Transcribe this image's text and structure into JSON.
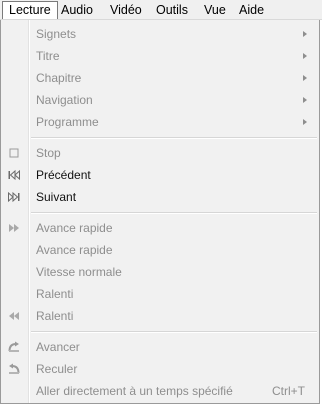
{
  "menubar": {
    "items": [
      {
        "label": "Lecture"
      },
      {
        "label": "Audio"
      },
      {
        "label": "Vidéo"
      },
      {
        "label": "Outils"
      },
      {
        "label": "Vue"
      },
      {
        "label": "Aide"
      }
    ]
  },
  "menu": {
    "items": [
      {
        "label": "Signets"
      },
      {
        "label": "Titre"
      },
      {
        "label": "Chapitre"
      },
      {
        "label": "Navigation"
      },
      {
        "label": "Programme"
      },
      {
        "label": "Stop"
      },
      {
        "label": "Précédent"
      },
      {
        "label": "Suivant"
      },
      {
        "label": "Avance rapide"
      },
      {
        "label": "Avance rapide"
      },
      {
        "label": "Vitesse normale"
      },
      {
        "label": "Ralenti"
      },
      {
        "label": "Ralenti"
      },
      {
        "label": "Avancer"
      },
      {
        "label": "Reculer"
      },
      {
        "label": "Aller directement à un temps spécifié",
        "shortcut": "Ctrl+T"
      }
    ]
  }
}
